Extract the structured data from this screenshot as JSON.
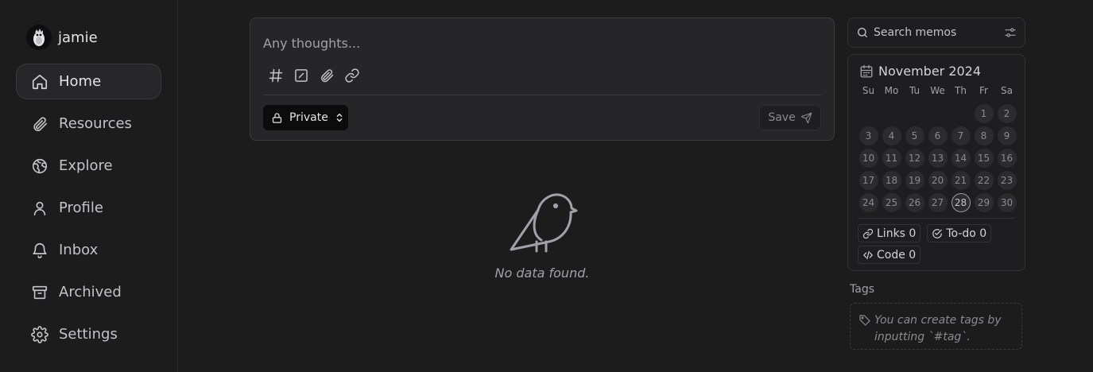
{
  "user": {
    "name": "jamie"
  },
  "nav": [
    {
      "label": "Home",
      "icon": "home-icon",
      "active": true
    },
    {
      "label": "Resources",
      "icon": "paperclip-icon"
    },
    {
      "label": "Explore",
      "icon": "globe-icon"
    },
    {
      "label": "Profile",
      "icon": "user-icon"
    },
    {
      "label": "Inbox",
      "icon": "bell-icon"
    },
    {
      "label": "Archived",
      "icon": "archive-icon"
    },
    {
      "label": "Settings",
      "icon": "gear-icon"
    }
  ],
  "editor": {
    "placeholder": "Any thoughts...",
    "tools": [
      "hashtag-icon",
      "checkbox-icon",
      "paperclip-icon",
      "link-icon"
    ],
    "visibility": "Private",
    "save_label": "Save"
  },
  "empty": {
    "text": "No data found."
  },
  "search": {
    "placeholder": "Search memos"
  },
  "calendar": {
    "title": "November 2024",
    "weekdays": [
      "Su",
      "Mo",
      "Tu",
      "We",
      "Th",
      "Fr",
      "Sa"
    ],
    "first_weekday_index": 5,
    "days_in_month": 30,
    "today": 28
  },
  "stats": {
    "links": "Links 0",
    "todo": "To-do 0",
    "code": "Code 0"
  },
  "tags": {
    "title": "Tags",
    "hint": "You can create tags by inputting `#tag`."
  },
  "colors": {
    "background": "#1c1c1d",
    "panel": "#262628",
    "border": "#3a3a3d",
    "text": "#d4d4d8",
    "muted": "#a1a1aa"
  }
}
